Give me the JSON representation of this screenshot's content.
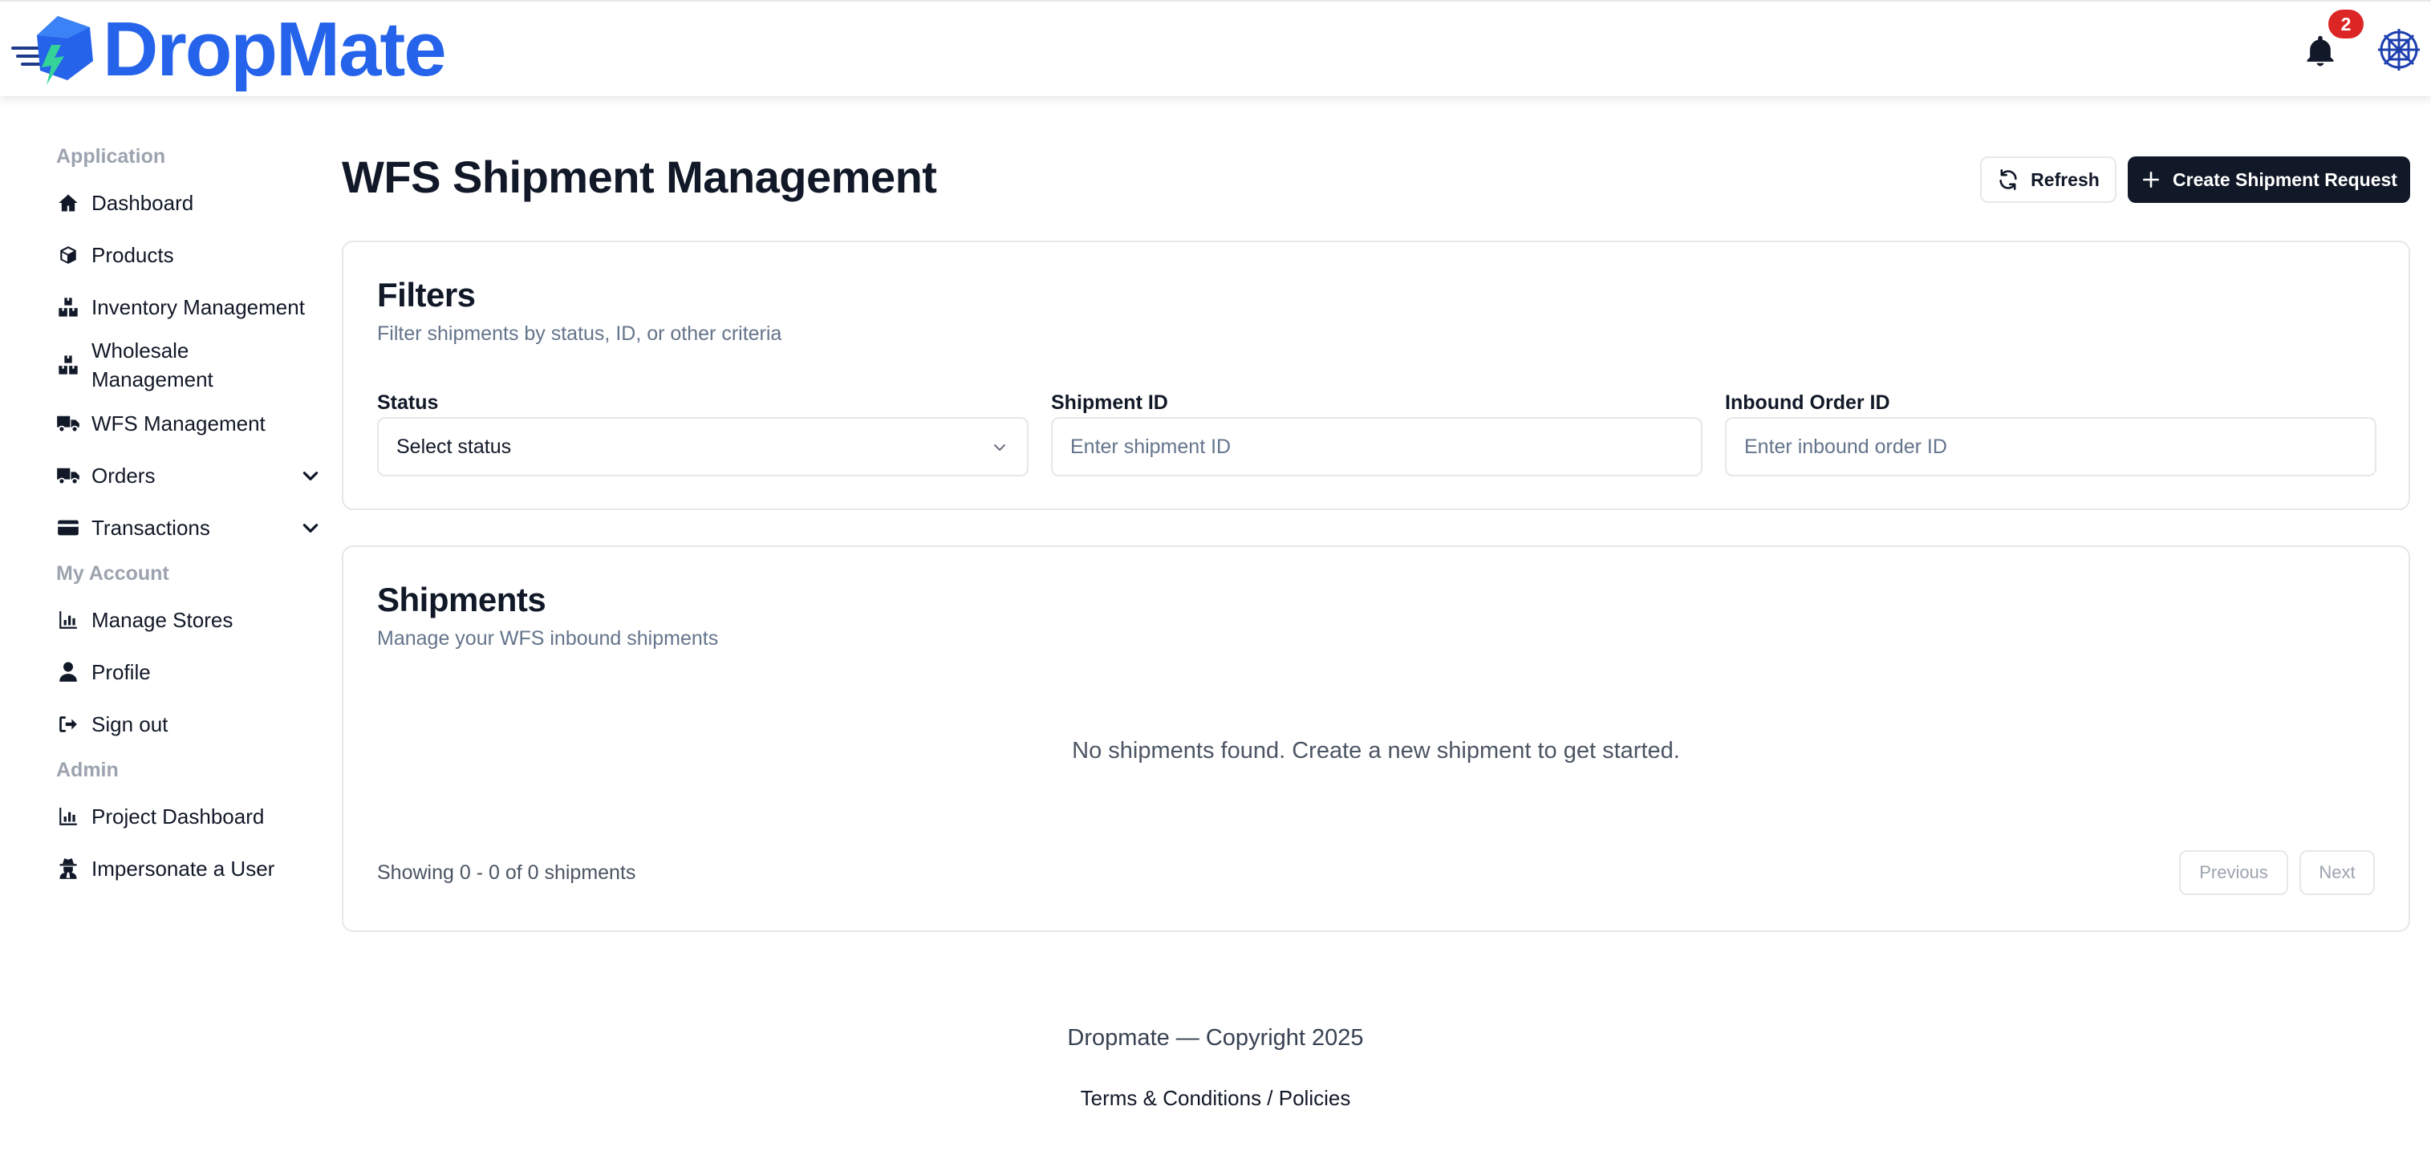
{
  "header": {
    "logo_text": "DropMate",
    "notification_count": "2",
    "icons": {
      "bell": "bell-icon",
      "avatar": "avatar-icon"
    },
    "brand_color": "#2563eb"
  },
  "sidebar": {
    "sections": [
      {
        "title": "Application",
        "items": [
          {
            "label": "Dashboard",
            "icon": "home-icon"
          },
          {
            "label": "Products",
            "icon": "box-icon"
          },
          {
            "label": "Inventory Management",
            "icon": "boxes-icon"
          },
          {
            "label": "Wholesale Management",
            "icon": "boxes-icon"
          },
          {
            "label": "WFS Management",
            "icon": "truck-icon"
          },
          {
            "label": "Orders",
            "icon": "truck-icon",
            "expandable": true
          },
          {
            "label": "Transactions",
            "icon": "credit-card-icon",
            "expandable": true
          }
        ]
      },
      {
        "title": "My Account",
        "items": [
          {
            "label": "Manage Stores",
            "icon": "chart-icon"
          },
          {
            "label": "Profile",
            "icon": "user-icon"
          },
          {
            "label": "Sign out",
            "icon": "sign-out-icon"
          }
        ]
      },
      {
        "title": "Admin",
        "items": [
          {
            "label": "Project Dashboard",
            "icon": "chart-icon"
          },
          {
            "label": "Impersonate a User",
            "icon": "user-secret-icon"
          }
        ]
      }
    ]
  },
  "main": {
    "title": "WFS Shipment Management",
    "refresh_label": "Refresh",
    "create_label": "Create Shipment Request",
    "filters": {
      "title": "Filters",
      "subtitle": "Filter shipments by status, ID, or other criteria",
      "status_label": "Status",
      "status_value": "Select status",
      "shipment_id_label": "Shipment ID",
      "shipment_id_placeholder": "Enter shipment ID",
      "inbound_label": "Inbound Order ID",
      "inbound_placeholder": "Enter inbound order ID"
    },
    "shipments": {
      "title": "Shipments",
      "subtitle": "Manage your WFS inbound shipments",
      "empty_message": "No shipments found. Create a new shipment to get started.",
      "showing": "Showing 0 - 0 of 0 shipments",
      "previous_label": "Previous",
      "next_label": "Next"
    }
  },
  "footer": {
    "copyright": "Dropmate — Copyright 2025",
    "link": "Terms & Conditions / Policies"
  }
}
